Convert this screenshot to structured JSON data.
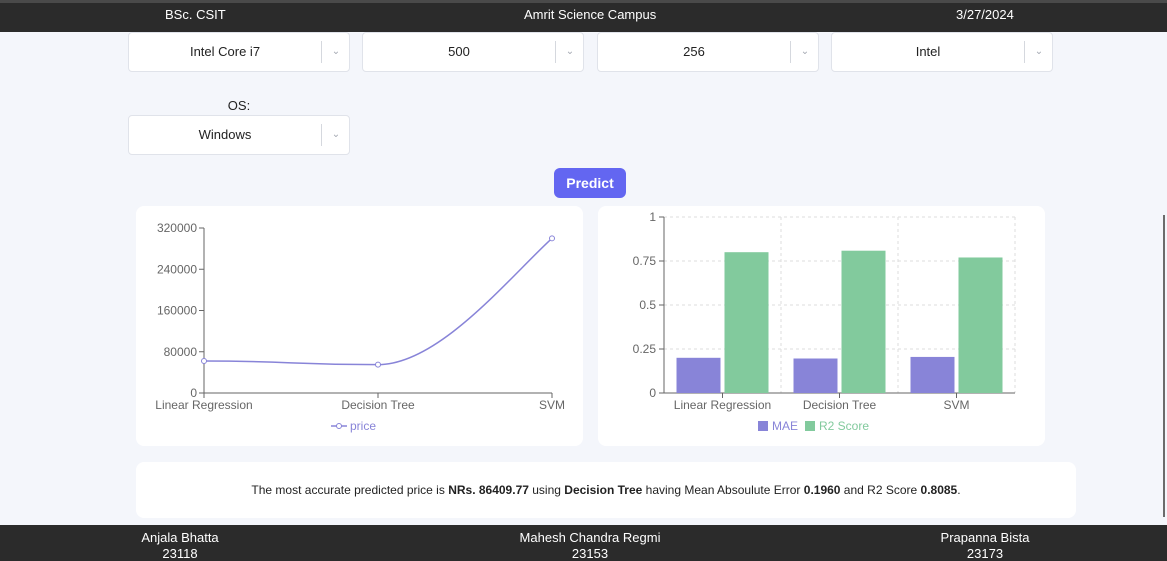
{
  "header": {
    "program": "BSc. CSIT",
    "campus": "Amrit Science Campus",
    "date": "3/27/2024"
  },
  "form": {
    "processor": "Intel Core i7",
    "storage": "500",
    "ram": "256",
    "gpu": "Intel",
    "os_label": "OS:",
    "os": "Windows"
  },
  "predict_button": "Predict",
  "charts": {
    "line_legend": "price",
    "bar_legend_mae": "MAE",
    "bar_legend_r2": "R2 Score"
  },
  "chart_data": [
    {
      "type": "line",
      "categories": [
        "Linear Regression",
        "Decision Tree",
        "SVM"
      ],
      "series": [
        {
          "name": "price",
          "values": [
            62000,
            55000,
            300000
          ]
        }
      ],
      "yticks": [
        "0",
        "80000",
        "160000",
        "240000",
        "320000"
      ],
      "ylim": [
        0,
        320000
      ],
      "legend": "bottom",
      "color": "#8884d8"
    },
    {
      "type": "bar",
      "categories": [
        "Linear Regression",
        "Decision Tree",
        "SVM"
      ],
      "series": [
        {
          "name": "MAE",
          "values": [
            0.2,
            0.196,
            0.205
          ],
          "color": "#8884d8"
        },
        {
          "name": "R2 Score",
          "values": [
            0.8,
            0.8085,
            0.77
          ],
          "color": "#82ca9d"
        }
      ],
      "yticks": [
        "0",
        "0.25",
        "0.5",
        "0.75",
        "1"
      ],
      "ylim": [
        0,
        1
      ],
      "grid": true,
      "legend": "bottom"
    }
  ],
  "result": {
    "prefix": "The most accurate predicted price is ",
    "price": "NRs. 86409.77",
    "using": " using ",
    "model": "Decision Tree",
    "having": " having Mean Absoulute Error ",
    "mae": "0.1960",
    "and": " and R2 Score ",
    "r2": "0.8085",
    "suffix": "."
  },
  "footer": {
    "people": [
      {
        "name": "Anjala Bhatta",
        "id": "23118"
      },
      {
        "name": "Mahesh Chandra Regmi",
        "id": "23153"
      },
      {
        "name": "Prapanna Bista",
        "id": "23173"
      }
    ]
  }
}
